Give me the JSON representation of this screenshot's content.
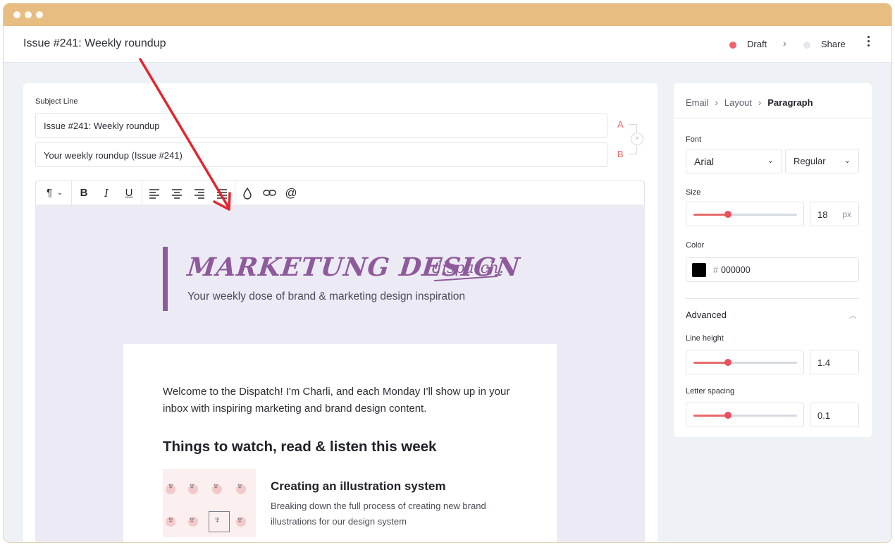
{
  "header": {
    "title": "Issue #241: Weekly roundup",
    "status_draft": "Draft",
    "status_share": "Share"
  },
  "subject": {
    "label": "Subject Line",
    "variant_a": "Issue #241: Weekly roundup",
    "variant_b": "Your weekly roundup (Issue #241)",
    "tag_a": "A",
    "tag_b": "B"
  },
  "toolbar": {
    "items": [
      "paragraph-icon",
      "bold-icon",
      "italic-icon",
      "underline-icon",
      "align-left-icon",
      "align-center-icon",
      "align-right-icon",
      "align-justify-icon",
      "color-drop-icon",
      "link-icon",
      "mention-icon"
    ]
  },
  "email": {
    "brand": "MARKETUNG DESIGN",
    "brand_script": "dispatch.",
    "tagline": "Your weekly dose of brand & marketing design inspiration",
    "welcome": "Welcome to the Dispatch! I'm Charli, and each Monday I'll show up in your inbox with inspiring marketing and brand design content.",
    "section_title": "Things to watch, read & listen this week",
    "article_title": "Creating an illustration system",
    "article_desc": "Breaking down the full process of creating new brand illustrations for our design system"
  },
  "panel": {
    "breadcrumb": [
      "Email",
      "Layout",
      "Paragraph"
    ],
    "font_label": "Font",
    "font_family": "Arial",
    "font_weight": "Regular",
    "size_label": "Size",
    "size_value": "18",
    "size_unit": "px",
    "size_slider": 0.33,
    "color_label": "Color",
    "color_hash": "#",
    "color_value": "000000",
    "advanced_label": "Advanced",
    "line_height_label": "Line height",
    "line_height_value": "1.4",
    "line_height_slider": 0.33,
    "letter_spacing_label": "Letter spacing",
    "letter_spacing_value": "0.1",
    "letter_spacing_slider": 0.33
  },
  "colors": {
    "chrome": "#e8bd82",
    "accent": "#e8515d",
    "brand": "#8e5a9b",
    "draft_dot": "#f0626c",
    "share_dot": "#e4e7ec"
  }
}
